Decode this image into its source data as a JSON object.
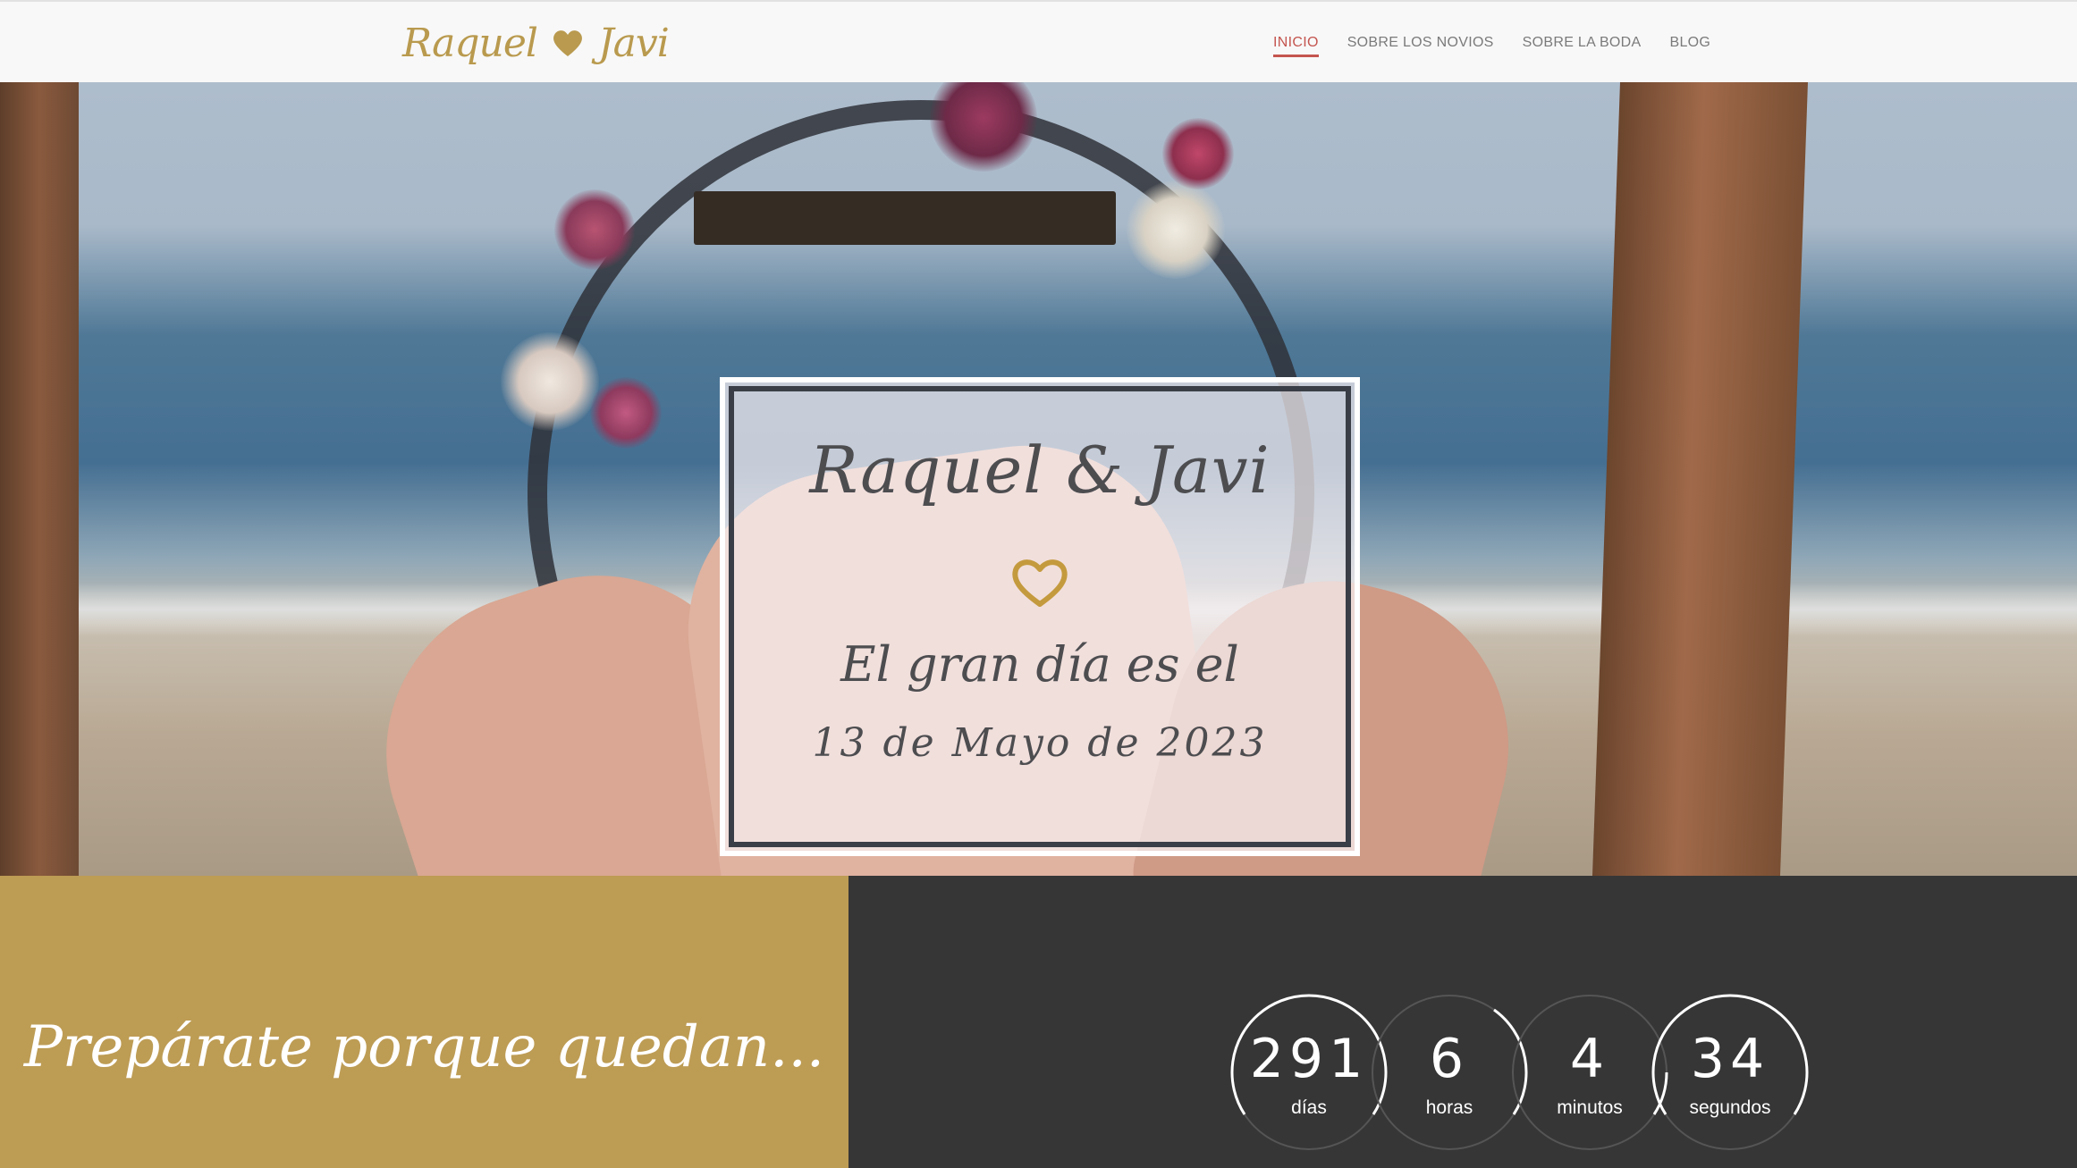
{
  "header": {
    "logo": {
      "name_left": "Raquel",
      "name_right": "Javi"
    },
    "nav": [
      {
        "label": "INICIO",
        "active": true
      },
      {
        "label": "SOBRE LOS NOVIOS",
        "active": false
      },
      {
        "label": "SOBRE LA BODA",
        "active": false
      },
      {
        "label": "BLOG",
        "active": false
      }
    ]
  },
  "hero": {
    "title": "Raquel & Javi",
    "subtitle": "El gran día es el",
    "date": "13 de Mayo de 2023",
    "icon": "heart-outline-icon"
  },
  "countdown": {
    "intro": "Prepárate porque quedan...",
    "units": [
      {
        "value": "291",
        "label": "días"
      },
      {
        "value": "6",
        "label": "horas"
      },
      {
        "value": "4",
        "label": "minutos"
      },
      {
        "value": "34",
        "label": "segundos"
      }
    ]
  },
  "colors": {
    "gold": "#bd9c54",
    "accent_red": "#c4554f",
    "dark": "#363636"
  }
}
